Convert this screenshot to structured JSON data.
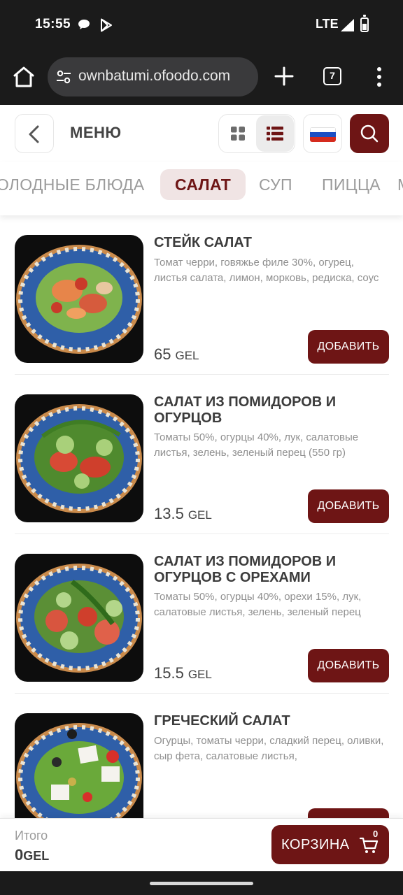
{
  "status_bar": {
    "time": "15:55",
    "network": "LTE",
    "icons": [
      "message-icon",
      "play-store-icon",
      "signal-icon",
      "battery-icon"
    ]
  },
  "browser": {
    "url": "ownbatumi.ofoodo.com",
    "tab_count": "7",
    "icons": [
      "home-icon",
      "site-settings-icon",
      "new-tab-icon",
      "tabs-icon",
      "more-menu-icon"
    ]
  },
  "header": {
    "title": "МЕНЮ",
    "icons": [
      "back-arrow-icon",
      "grid-view-icon",
      "list-view-icon",
      "russian-flag-icon",
      "search-icon"
    ]
  },
  "categories": [
    {
      "label": "ХОЛОДНЫЕ БЛЮДА",
      "active": false
    },
    {
      "label": "САЛАТ",
      "active": true
    },
    {
      "label": "СУП",
      "active": false
    },
    {
      "label": "ПИЦЦА",
      "active": false
    },
    {
      "label": "М",
      "active": false
    }
  ],
  "items": [
    {
      "name": "СТЕЙК САЛАТ",
      "description": "Томат черри, говяжье филе 30%, огурец, листья салата, лимон, морковь, редиска, соус",
      "price": "65",
      "currency": "GEL",
      "button": "ДОБАВИТЬ"
    },
    {
      "name": "САЛАТ ИЗ ПОМИДОРОВ И ОГУРЦОВ",
      "description": "Томаты 50%, огурцы 40%, лук, салатовые листья, зелень, зеленый перец (550 гр)",
      "price": "13.5",
      "currency": "GEL",
      "button": "ДОБАВИТЬ"
    },
    {
      "name": "САЛАТ ИЗ ПОМИДОРОВ И ОГУРЦОВ С ОРЕХАМИ",
      "description": "Томаты 50%, огурцы 40%, орехи 15%, лук, салатовые листья, зелень, зеленый перец",
      "price": "15.5",
      "currency": "GEL",
      "button": "ДОБАВИТЬ"
    },
    {
      "name": "ГРЕЧЕСКИЙ САЛАТ",
      "description": "Огурцы, томаты черри, сладкий перец, оливки, сыр фета, салатовые листья,",
      "price": "",
      "currency": "",
      "button": ""
    }
  ],
  "cart": {
    "total_label": "Итого",
    "total_value": "0",
    "currency": "GEL",
    "button_label": "КОРЗИНА",
    "count": "0"
  },
  "colors": {
    "accent": "#6e1515",
    "active_tab_bg": "#f0e4e4",
    "system_bar": "#1b1b1b"
  }
}
